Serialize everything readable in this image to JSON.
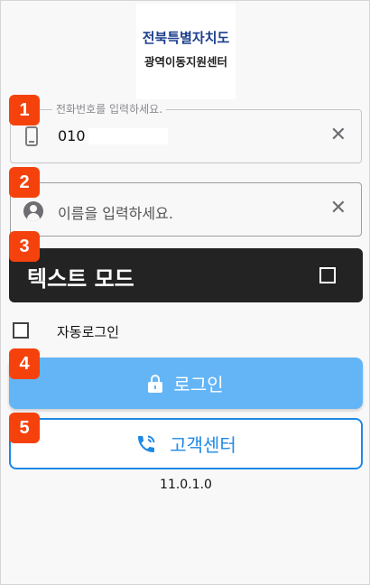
{
  "logo": {
    "line1": "전북특별자치도",
    "line2": "광역이동지원센터"
  },
  "phone_field": {
    "legend": "전화번호를 입력하세요.",
    "value": "010",
    "clear": "✕",
    "icon": "phone-icon"
  },
  "name_field": {
    "placeholder": "이름을 입력하세요.",
    "clear": "✕",
    "icon": "person-icon"
  },
  "text_mode": {
    "label": "텍스트 모드",
    "checked": false
  },
  "auto_login": {
    "label": "자동로그인",
    "checked": false
  },
  "login_button": {
    "label": "로그인",
    "icon": "lock-icon",
    "color": "#64b5f6"
  },
  "cs_button": {
    "label": "고객센터",
    "icon": "phone-call-icon",
    "color": "#1e88e5"
  },
  "version": "11.0.1.0",
  "badges": [
    "1",
    "2",
    "3",
    "4",
    "5"
  ],
  "colors": {
    "badge": "#f5420d",
    "text_mode_bg": "#232323"
  }
}
